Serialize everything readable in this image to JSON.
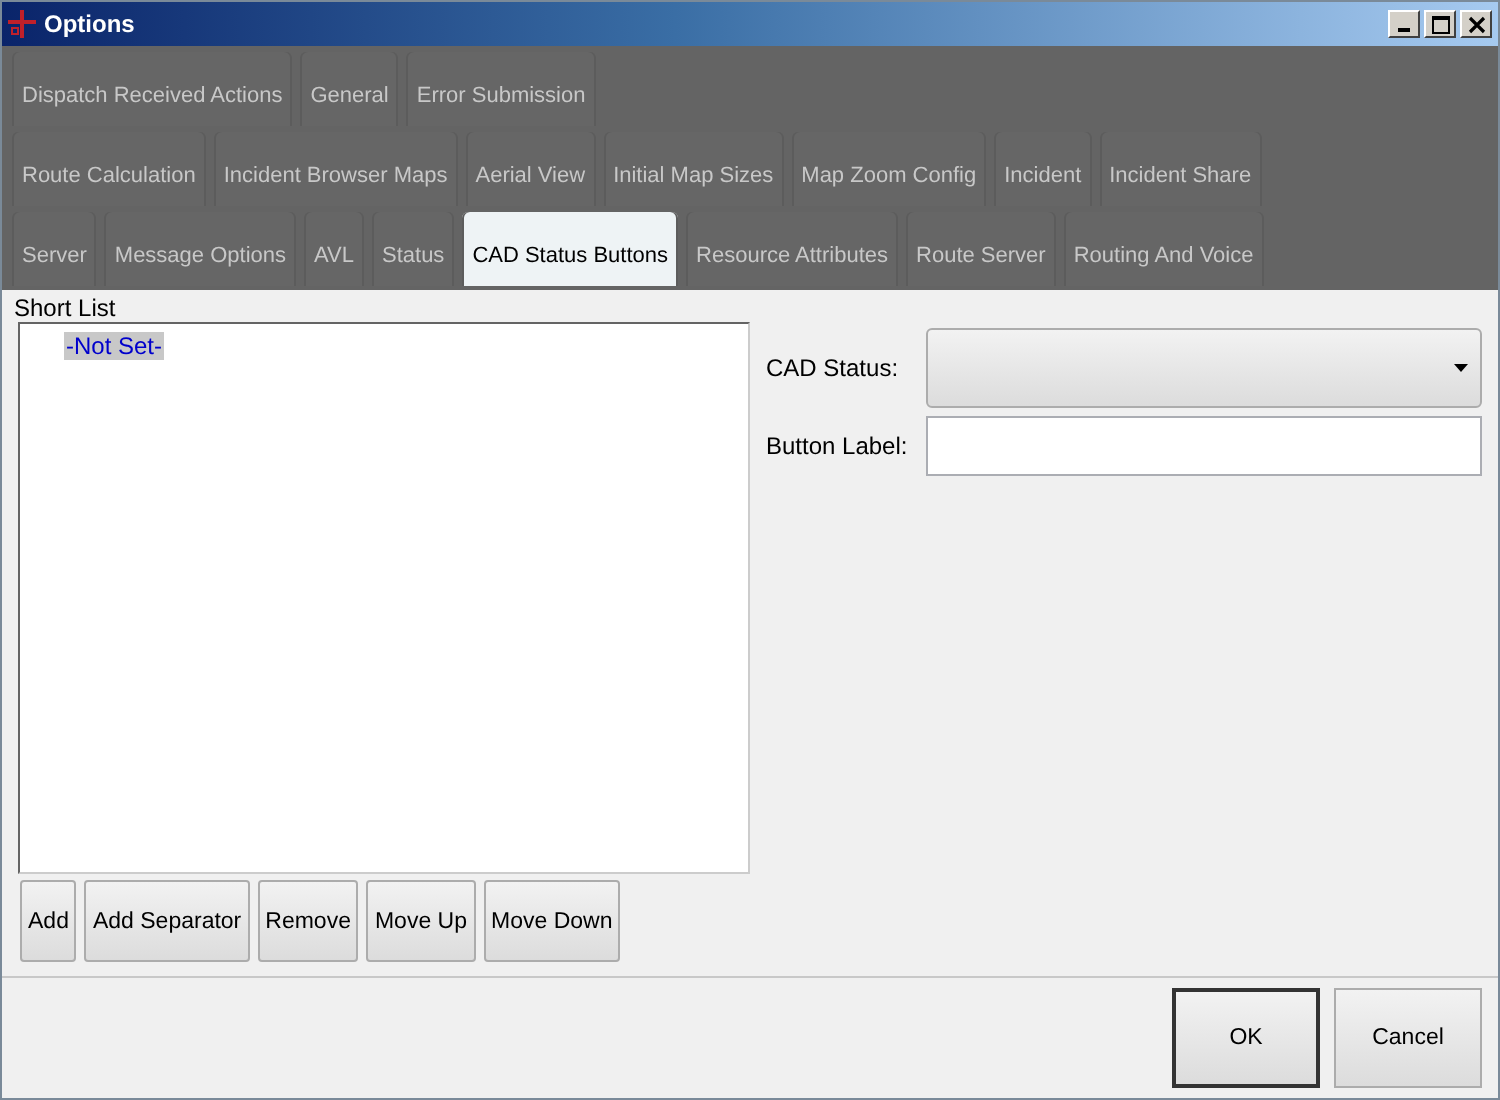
{
  "window": {
    "title": "Options"
  },
  "tab_rows": [
    [
      {
        "label": "Dispatch Received Actions",
        "selected": false
      },
      {
        "label": "General",
        "selected": false
      },
      {
        "label": "Error Submission",
        "selected": false
      }
    ],
    [
      {
        "label": "Route Calculation",
        "selected": false
      },
      {
        "label": "Incident Browser Maps",
        "selected": false
      },
      {
        "label": "Aerial View",
        "selected": false
      },
      {
        "label": "Initial Map Sizes",
        "selected": false
      },
      {
        "label": "Map Zoom Config",
        "selected": false
      },
      {
        "label": "Incident",
        "selected": false
      },
      {
        "label": "Incident Share",
        "selected": false
      }
    ],
    [
      {
        "label": "Server",
        "selected": false
      },
      {
        "label": "Message Options",
        "selected": false
      },
      {
        "label": "AVL",
        "selected": false
      },
      {
        "label": "Status",
        "selected": false
      },
      {
        "label": "CAD Status Buttons",
        "selected": true
      },
      {
        "label": "Resource Attributes",
        "selected": false
      },
      {
        "label": "Route Server",
        "selected": false
      },
      {
        "label": "Routing And Voice",
        "selected": false
      }
    ]
  ],
  "short_list": {
    "label": "Short List",
    "items": [
      {
        "label": "-Not Set-",
        "selected": true
      }
    ]
  },
  "list_buttons": [
    "Add",
    "Add Separator",
    "Remove",
    "Move Up",
    "Move Down"
  ],
  "cad_status": {
    "label": "CAD Status:"
  },
  "button_label": {
    "label": "Button Label:"
  },
  "dialog_buttons": [
    {
      "label": "OK",
      "default": true
    },
    {
      "label": "Cancel",
      "default": false
    }
  ]
}
